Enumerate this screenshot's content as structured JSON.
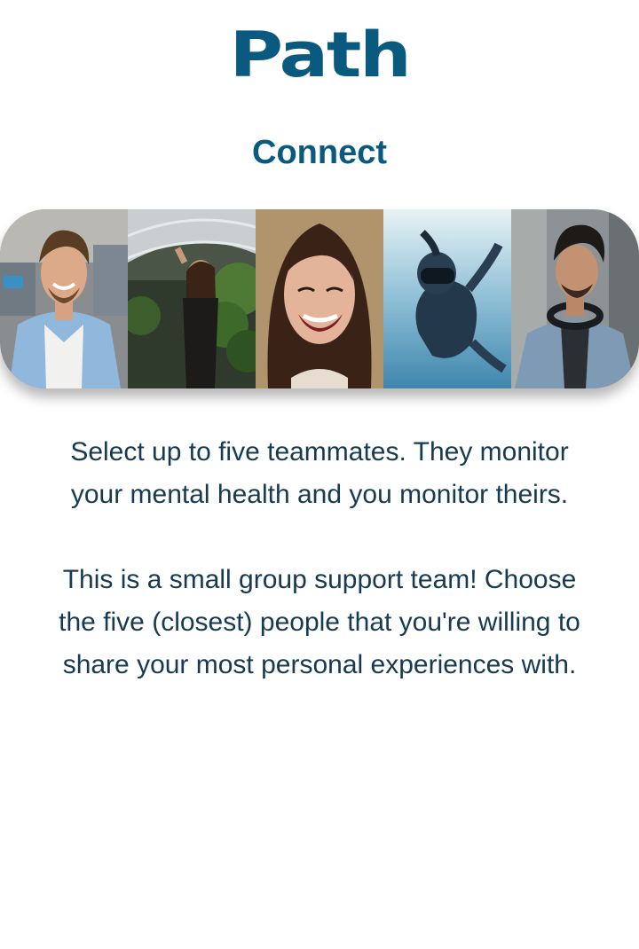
{
  "app": {
    "logo_text": "Path",
    "brand_color": "#0a5a80"
  },
  "header": {
    "title": "Connect"
  },
  "photo_strip": {
    "photos": [
      {
        "icon": "smiling-man-photo"
      },
      {
        "icon": "woman-in-greenhouse-photo"
      },
      {
        "icon": "laughing-woman-photo"
      },
      {
        "icon": "underwater-swimmer-photo"
      },
      {
        "icon": "man-with-headphones-photo"
      }
    ]
  },
  "body": {
    "paragraph_1": "Select up to five teammates. They monitor your mental health and you monitor theirs.",
    "paragraph_2": "This is a small group support team! Choose the five (closest) people that you're willing to share your most personal experiences with.",
    "text_color": "#153a52"
  }
}
